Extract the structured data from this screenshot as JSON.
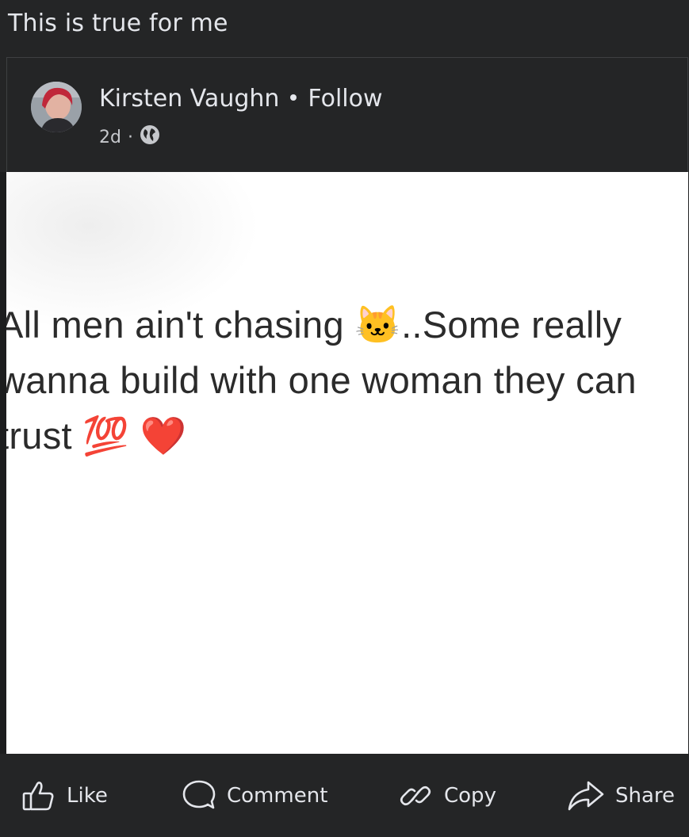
{
  "caption": "This is true for me",
  "post": {
    "author": "Kirsten Vaughn",
    "follow_label": "Follow",
    "time": "2d",
    "time_separator": "·",
    "audience_icon": "globe-icon"
  },
  "image": {
    "lines": [
      "All men ain't chasing 🐱..Some really",
      "wanna build with one woman they can",
      "trust 💯 ❤️"
    ]
  },
  "actions": {
    "like": "Like",
    "comment": "Comment",
    "copy": "Copy",
    "share": "Share"
  },
  "colors": {
    "background": "#242526",
    "text": "#e4e6eb",
    "image_bg": "#ffffff"
  }
}
